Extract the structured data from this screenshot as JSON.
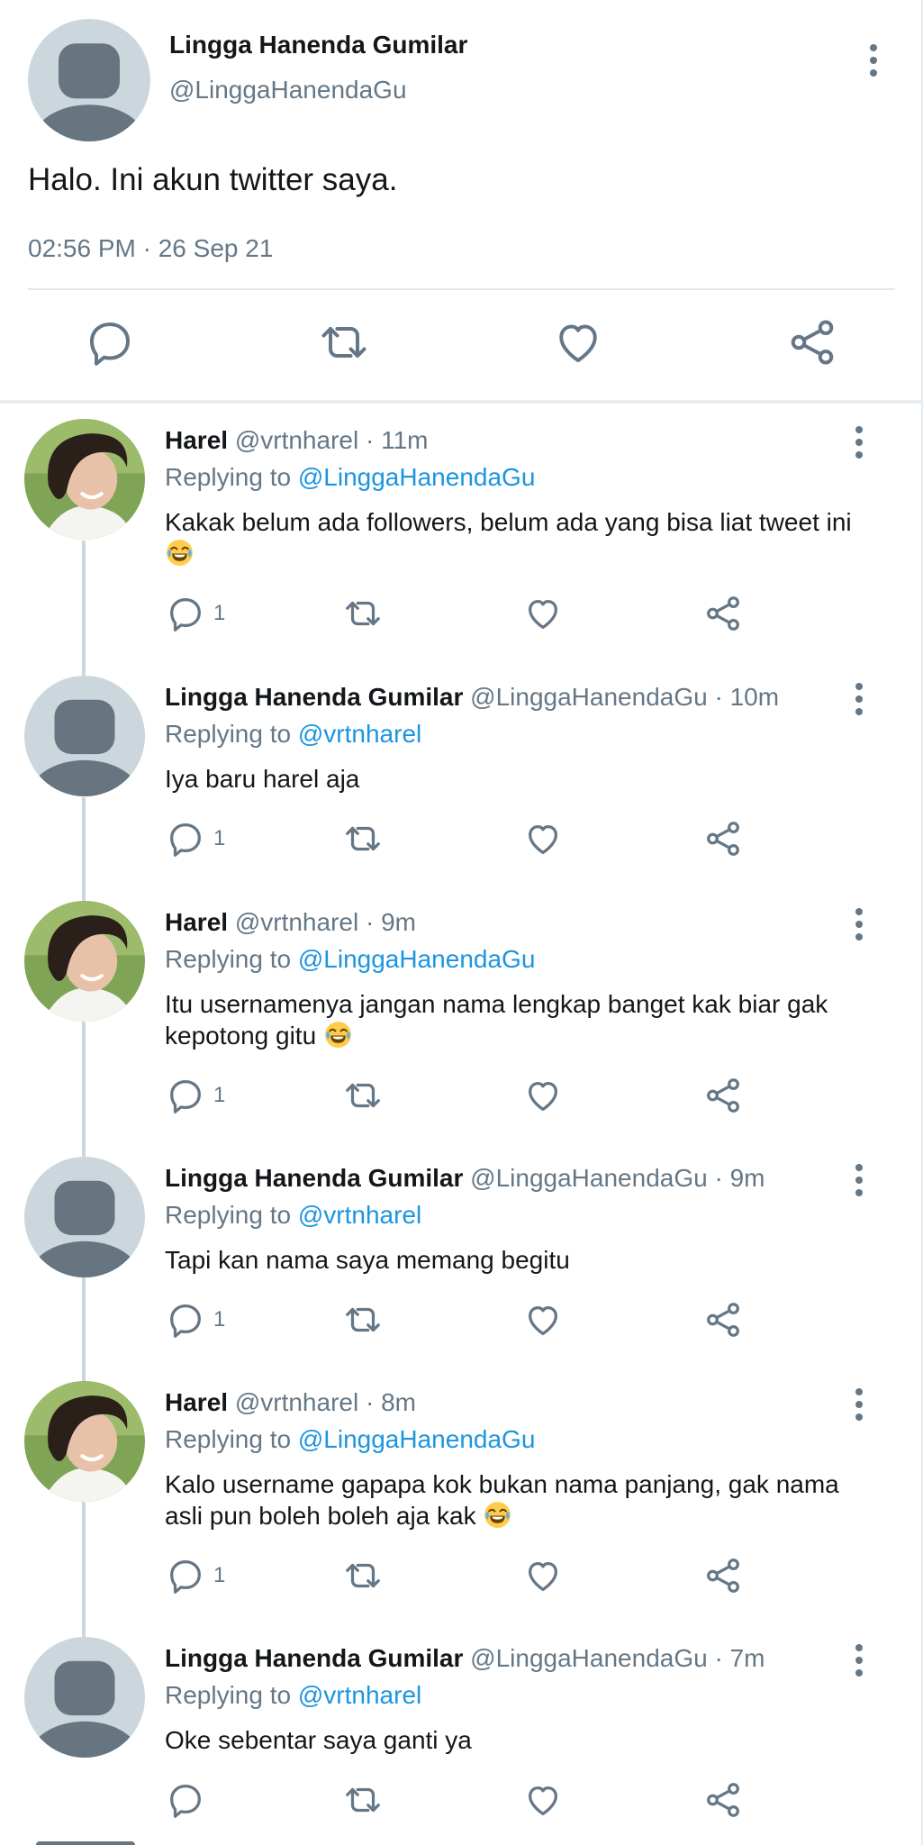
{
  "main_tweet": {
    "author_name": "Lingga Hanenda Gumilar",
    "author_handle": "@LinggaHanendaGu",
    "text": "Halo. Ini akun twitter saya.",
    "timestamp": "02:56 PM · 26 Sep 21",
    "icons": [
      "more-vertical-icon",
      "reply-icon",
      "retweet-icon",
      "like-icon",
      "share-icon"
    ]
  },
  "replies": [
    {
      "name": "Harel",
      "handle_time": "@vrtnharel · 11m",
      "replying_label": "Replying to",
      "replying_to": "@LinggaHanendaGu",
      "text": "Kakak belum ada followers, belum ada yang bisa liat tweet ini",
      "emoji": "face-with-tears-of-joy",
      "reply_count": "1",
      "avatar": "photo"
    },
    {
      "name": "Lingga Hanenda Gumilar",
      "handle_time": "@LinggaHanendaGu · 10m",
      "replying_label": "Replying to",
      "replying_to": "@vrtnharel",
      "text": "Iya baru harel aja",
      "reply_count": "1",
      "avatar": "default"
    },
    {
      "name": "Harel",
      "handle_time": "@vrtnharel · 9m",
      "replying_label": "Replying to",
      "replying_to": "@LinggaHanendaGu",
      "text": "Itu usernamenya jangan nama lengkap banget kak biar gak kepotong gitu",
      "emoji": "face-with-tears-of-joy",
      "reply_count": "1",
      "avatar": "photo"
    },
    {
      "name": "Lingga Hanenda Gumilar",
      "handle_time": "@LinggaHanendaGu · 9m",
      "replying_label": "Replying to",
      "replying_to": "@vrtnharel",
      "text": "Tapi kan nama saya memang begitu",
      "reply_count": "1",
      "avatar": "default"
    },
    {
      "name": "Harel",
      "handle_time": "@vrtnharel · 8m",
      "replying_label": "Replying to",
      "replying_to": "@LinggaHanendaGu",
      "text": "Kalo username gapapa kok bukan nama panjang, gak nama asli pun boleh boleh aja kak",
      "emoji": "face-with-tears-of-joy",
      "reply_count": "1",
      "avatar": "photo"
    },
    {
      "name": "Lingga Hanenda Gumilar",
      "handle_time": "@LinggaHanendaGu · 7m",
      "replying_label": "Replying to",
      "replying_to": "@vrtnharel",
      "text": "Oke sebentar saya ganti ya",
      "reply_count": "",
      "avatar": "default"
    }
  ],
  "colors": {
    "text_primary": "#14171a",
    "text_secondary": "#657786",
    "link": "#1b95e0",
    "icon": "#657786",
    "avatar_bg": "#ccd6dd",
    "avatar_fg": "#66757f",
    "divider": "#e1e8ed"
  }
}
